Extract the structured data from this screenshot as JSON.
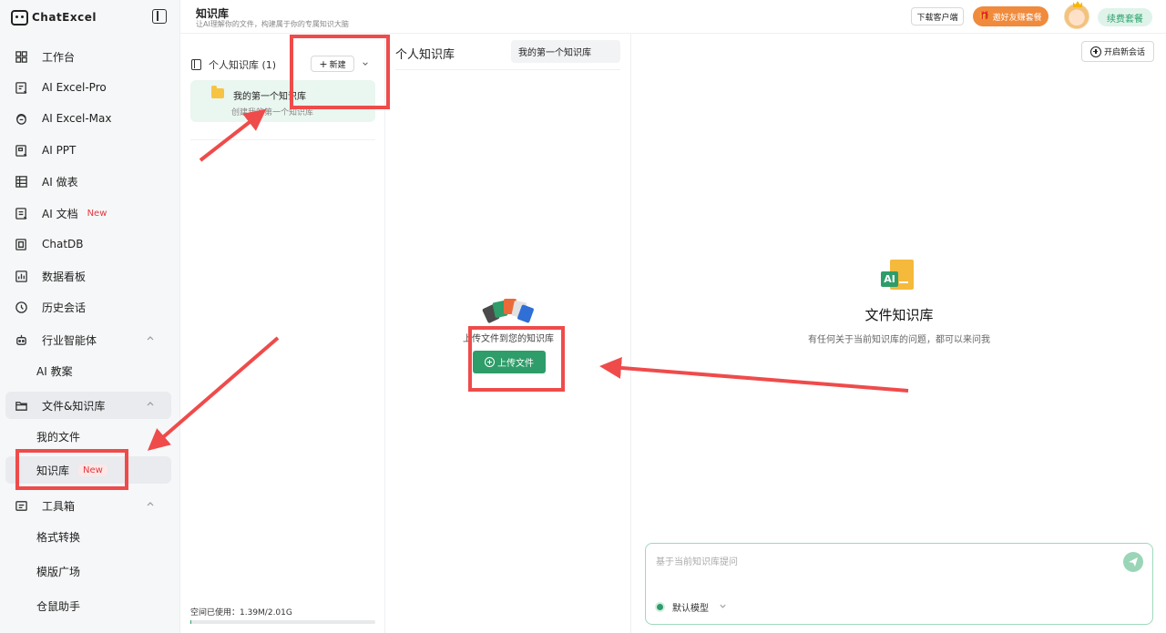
{
  "app": {
    "logo_text": "ChatExcel"
  },
  "sidebar": {
    "items": [
      {
        "label": "工作台",
        "icon": "grid-icon"
      },
      {
        "label": "AI Excel-Pro",
        "icon": "excel-pro-icon"
      },
      {
        "label": "AI Excel-Max",
        "icon": "excel-max-icon"
      },
      {
        "label": "AI PPT",
        "icon": "ppt-icon"
      },
      {
        "label": "AI 做表",
        "icon": "table-icon"
      },
      {
        "label": "AI 文档",
        "icon": "document-icon",
        "badge": "New"
      },
      {
        "label": "ChatDB",
        "icon": "database-icon"
      },
      {
        "label": "数据看板",
        "icon": "dashboard-icon"
      },
      {
        "label": "历史会话",
        "icon": "history-icon"
      },
      {
        "label": "行业智能体",
        "icon": "robot-icon"
      },
      {
        "label": "AI 教案"
      },
      {
        "label": "文件&知识库",
        "icon": "folder-open-icon"
      },
      {
        "label": "我的文件"
      },
      {
        "label": "知识库",
        "badge": "New"
      },
      {
        "label": "工具箱",
        "icon": "toolbox-icon"
      },
      {
        "label": "格式转换"
      },
      {
        "label": "模版广场"
      },
      {
        "label": "仓鼠助手"
      }
    ]
  },
  "header": {
    "title": "知识库",
    "subtitle": "让AI理解你的文件，构建属于你的专属知识大脑",
    "download_label": "下载客户端",
    "invite_label": "邀好友赚套餐",
    "renew_label": "续费套餐"
  },
  "kb_list": {
    "heading": "个人知识库 (1)",
    "new_label": "新建",
    "card_name": "我的第一个知识库",
    "card_desc": "创建我的第一个知识库",
    "space_label": "空间已使用：1.39M/2.01G",
    "space_fraction": 0.0007
  },
  "files": {
    "title": "个人知识库",
    "tab_label": "我的第一个知识库",
    "upload_hint": "上传文件到您的知识库",
    "upload_label": "上传文件"
  },
  "chat": {
    "new_chat_label": "开启新会话",
    "logo_badge": "AI",
    "title": "文件知识库",
    "subtitle": "有任何关于当前知识库的问题，都可以来问我",
    "input_placeholder": "基于当前知识库提问",
    "model_label": "默认模型"
  },
  "colors": {
    "accent_green": "#2e9d69",
    "annotation_red": "#ef4b4b",
    "invite_orange": "#f08a3c"
  }
}
